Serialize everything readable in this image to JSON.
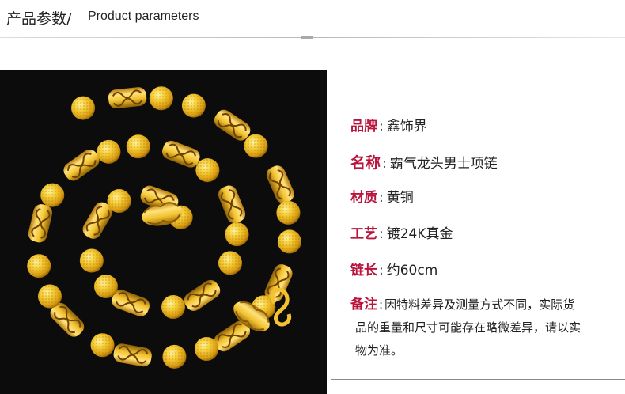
{
  "header": {
    "title_cn": "产品参数/",
    "title_en": "Product parameters"
  },
  "product_image": {
    "alt": "gold-chain-necklace-photo"
  },
  "specs": [
    {
      "label": "品牌",
      "value": "鑫饰界"
    },
    {
      "label": "名称",
      "value": "霸气龙头男士项链"
    },
    {
      "label": "材质",
      "value": "黄铜"
    },
    {
      "label": "工艺",
      "value": "镀24K真金"
    },
    {
      "label": "链长",
      "value": "约60cm"
    }
  ],
  "note": {
    "label": "备注",
    "line1": "因特料差异及测量方式不同，实际货",
    "line2": "品的重量和尺寸可能存在略微差异，请以实",
    "line3": "物为准。"
  },
  "colors": {
    "label": "#b8143c",
    "text": "#222222",
    "photo_bg": "#0c0c0c",
    "gold": "#f2c230"
  }
}
